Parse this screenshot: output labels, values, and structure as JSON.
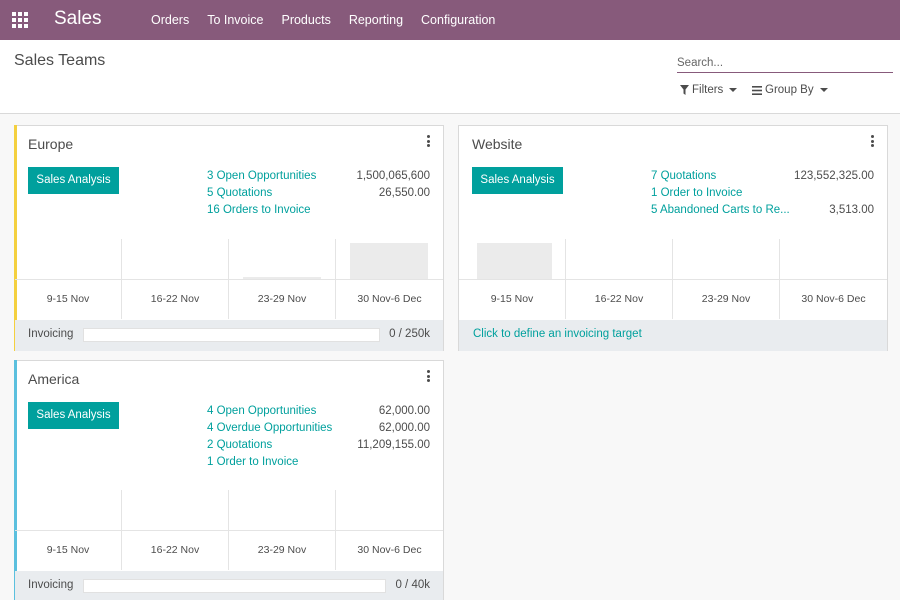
{
  "app": {
    "name": "Sales",
    "menu": [
      "Orders",
      "To Invoice",
      "Products",
      "Reporting",
      "Configuration"
    ]
  },
  "control": {
    "title": "Sales Teams",
    "search_placeholder": "Search...",
    "filters_label": "Filters",
    "group_by_label": "Group By"
  },
  "teams": [
    {
      "name": "Europe",
      "accent": "#f4d03f",
      "button": "Sales Analysis",
      "stats": [
        {
          "label": "3 Open Opportunities",
          "value": "1,500,065,600"
        },
        {
          "label": "5 Quotations",
          "value": "26,550.00"
        },
        {
          "label": "16 Orders to Invoice",
          "value": ""
        }
      ],
      "graph": {
        "labels": [
          "9-15 Nov",
          "16-22 Nov",
          "23-29 Nov",
          "30 Nov-6 Dec"
        ],
        "values": [
          0,
          0,
          0.05,
          1.0
        ]
      },
      "invoicing": {
        "label": "Invoicing",
        "value": "0 / 250k",
        "progress": 0
      }
    },
    {
      "name": "Website",
      "accent": "",
      "button": "Sales Analysis",
      "stats": [
        {
          "label": "7 Quotations",
          "value": "123,552,325.00"
        },
        {
          "label": "1 Order to Invoice",
          "value": ""
        },
        {
          "label": "5 Abandoned Carts to Re...",
          "value": "3,513.00"
        }
      ],
      "graph": {
        "labels": [
          "9-15 Nov",
          "16-22 Nov",
          "23-29 Nov",
          "30 Nov-6 Dec"
        ],
        "values": [
          1.0,
          0,
          0,
          0
        ]
      },
      "invoicing": {
        "link": "Click to define an invoicing target"
      }
    },
    {
      "name": "America",
      "accent": "#5bc0de",
      "button": "Sales Analysis",
      "stats": [
        {
          "label": "4 Open Opportunities",
          "value": "62,000.00"
        },
        {
          "label": "4 Overdue Opportunities",
          "value": "62,000.00"
        },
        {
          "label": "2 Quotations",
          "value": "11,209,155.00"
        },
        {
          "label": "1 Order to Invoice",
          "value": ""
        }
      ],
      "graph": {
        "labels": [
          "9-15 Nov",
          "16-22 Nov",
          "23-29 Nov",
          "30 Nov-6 Dec"
        ],
        "values": [
          0,
          0,
          0,
          0
        ]
      },
      "invoicing": {
        "label": "Invoicing",
        "value": "0 / 40k",
        "progress": 0
      }
    }
  ]
}
